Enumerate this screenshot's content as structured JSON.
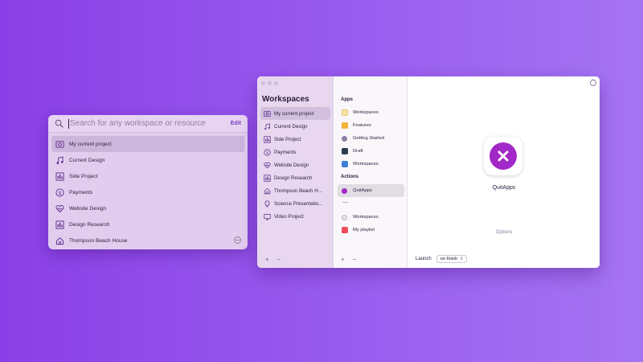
{
  "search": {
    "placeholder": "Search for any workspace or resource",
    "edit_label": "Edit",
    "items": [
      {
        "label": "My current project",
        "icon": "photo-icon"
      },
      {
        "label": "Current Design",
        "icon": "music-note-icon"
      },
      {
        "label": "Side Project",
        "icon": "chart-icon"
      },
      {
        "label": "Payments",
        "icon": "dollar-icon"
      },
      {
        "label": "Website Design",
        "icon": "heart-pulse-icon"
      },
      {
        "label": "Design Research",
        "icon": "chart-icon"
      },
      {
        "label": "Thompson Beach House",
        "icon": "house-icon"
      }
    ]
  },
  "window": {
    "sidebar": {
      "title": "Workspaces",
      "items": [
        {
          "label": "My current project",
          "icon": "photo-icon"
        },
        {
          "label": "Current Design",
          "icon": "music-note-icon"
        },
        {
          "label": "Side Project",
          "icon": "chart-icon"
        },
        {
          "label": "Payments",
          "icon": "dollar-icon"
        },
        {
          "label": "Website Design",
          "icon": "heart-pulse-icon"
        },
        {
          "label": "Design Research",
          "icon": "chart-icon"
        },
        {
          "label": "Thompson Beach H...",
          "icon": "house-icon"
        },
        {
          "label": "Science Presentatio...",
          "icon": "lightbulb-icon"
        },
        {
          "label": "Video Project",
          "icon": "monitor-icon"
        }
      ],
      "add_label": "+",
      "remove_label": "−"
    },
    "middle": {
      "apps_heading": "Apps",
      "apps": [
        {
          "label": "Workspaces",
          "color": "#f6e3a8"
        },
        {
          "label": "Features",
          "color": "#f0b23a"
        },
        {
          "label": "Getting Started",
          "color": "#8a7fa2"
        },
        {
          "label": "Draft",
          "color": "#2d3b4e"
        },
        {
          "label": "Workspaces",
          "color": "#3d7fd6"
        }
      ],
      "actions_heading": "Actions",
      "actions": [
        {
          "label": "QuitApps",
          "color": "#a228c7"
        }
      ],
      "separator": "—",
      "extras": [
        {
          "label": "Workspaces",
          "color": "#e8e3ec"
        },
        {
          "label": "My playlist",
          "color": "#f04a5b"
        }
      ],
      "add_label": "+",
      "remove_label": "−"
    },
    "detail": {
      "app_name": "QuitApps",
      "options_label": "Options",
      "launch_label": "Launch",
      "launch_value": "on finish"
    }
  }
}
